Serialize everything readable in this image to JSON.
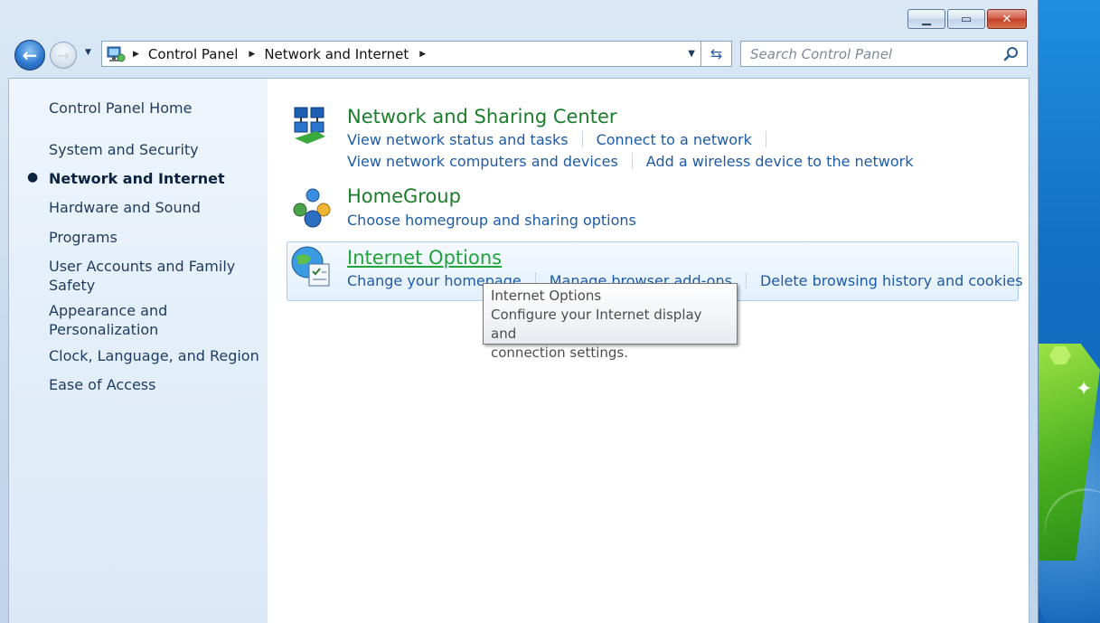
{
  "window": {
    "controls": {
      "minimize": "▭",
      "maximize": "□",
      "close": "✕"
    }
  },
  "navbar": {
    "breadcrumbs": [
      "Control Panel",
      "Network and Internet"
    ],
    "search_placeholder": "Search Control Panel"
  },
  "sidebar": {
    "items": [
      {
        "label": "Control Panel Home"
      },
      {
        "label": "System and Security"
      },
      {
        "label": "Network and Internet",
        "active": true
      },
      {
        "label": "Hardware and Sound"
      },
      {
        "label": "Programs"
      },
      {
        "label": "User Accounts and Family Safety"
      },
      {
        "label": "Appearance and Personalization"
      },
      {
        "label": "Clock, Language, and Region"
      },
      {
        "label": "Ease of Access"
      }
    ],
    "item_lines": {
      "user_accounts": [
        "User Accounts and Family",
        "Safety"
      ],
      "appearance": [
        "Appearance and",
        "Personalization"
      ]
    }
  },
  "categories": [
    {
      "title": "Network and Sharing Center",
      "icon": "network-sharing-icon",
      "tasks": [
        [
          "View network status and tasks",
          "Connect to a network"
        ],
        [
          "View network computers and devices",
          "Add a wireless device to the network"
        ]
      ]
    },
    {
      "title": "HomeGroup",
      "icon": "homegroup-icon",
      "tasks": [
        [
          "Choose homegroup and sharing options"
        ]
      ]
    },
    {
      "title": "Internet Options",
      "icon": "internet-options-icon",
      "hovered": true,
      "tasks": [
        [
          "Change your homepage",
          "Manage browser add-ons",
          "Delete browsing history and cookies"
        ]
      ]
    }
  ],
  "tooltip": {
    "title": "Internet Options",
    "line1": "Configure your Internet display and",
    "line2": "connection settings."
  }
}
